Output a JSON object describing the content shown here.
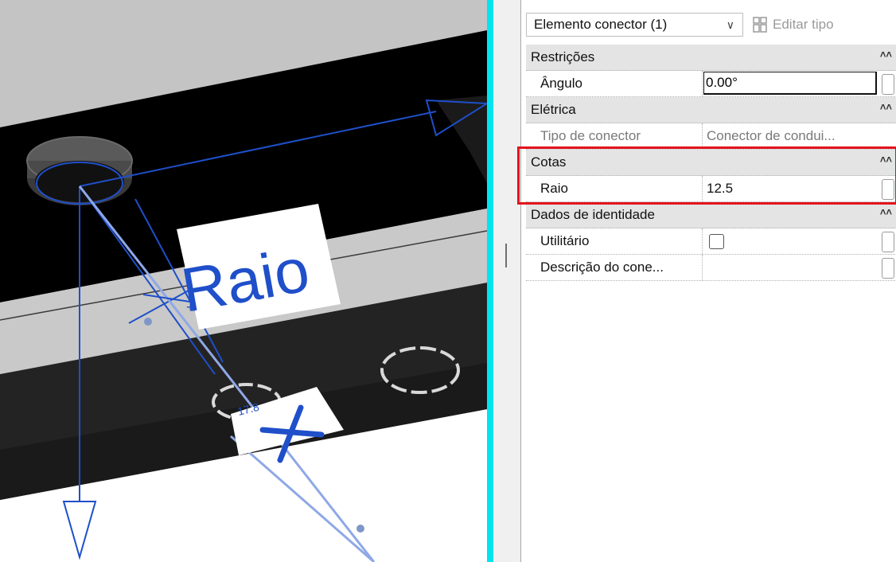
{
  "viewport": {
    "tag_text": "Raio",
    "dimension_value": "17.8"
  },
  "properties": {
    "type_selector": {
      "value": "Elemento conector (1)"
    },
    "edit_type_label": "Editar tipo",
    "groups": [
      {
        "label": "Restrições",
        "rows": [
          {
            "name": "Ângulo",
            "value": "0.00°"
          }
        ]
      },
      {
        "label": "Elétrica",
        "rows": [
          {
            "name": "Tipo de conector",
            "value": "Conector de condui..."
          }
        ]
      },
      {
        "label": "Cotas",
        "rows": [
          {
            "name": "Raio",
            "value": "12.5"
          }
        ]
      },
      {
        "label": "Dados de identidade",
        "rows": [
          {
            "name": "Utilitário",
            "value": ""
          },
          {
            "name": "Descrição do cone...",
            "value": ""
          }
        ]
      }
    ]
  },
  "colors": {
    "accent_divider": "#00e5f0",
    "selection_blue": "#1f4fc9",
    "highlight_red": "#e2141d"
  }
}
